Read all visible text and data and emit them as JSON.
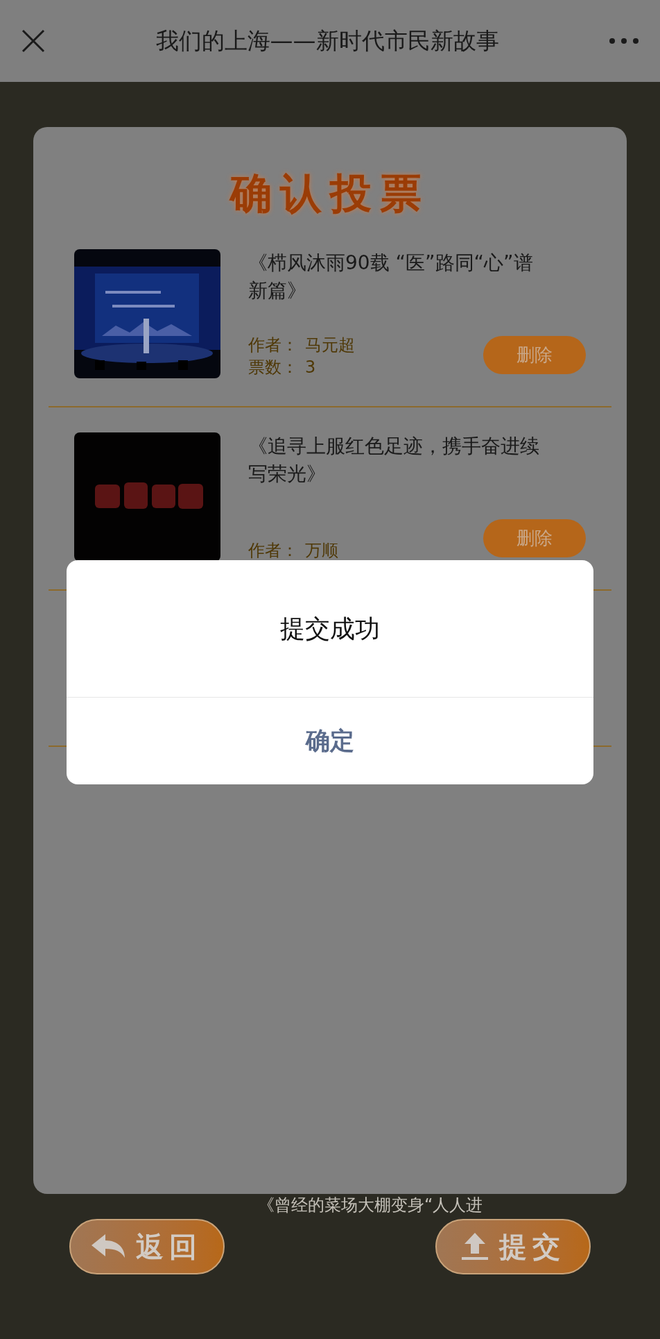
{
  "header": {
    "title": "我们的上海——新时代市民新故事"
  },
  "panel": {
    "title": "确认投票",
    "items": [
      {
        "title": "《栉风沐雨90载 “医”路同“心”谱新篇》",
        "author_label": "作者：",
        "author": "马元超",
        "votes_label": "票数：",
        "votes": "3",
        "delete_button": "删除"
      },
      {
        "title": "《追寻上服红色足迹，携手奋进续写荣光》",
        "author_label": "作者：",
        "author": "万顺",
        "delete_button": "删除"
      }
    ]
  },
  "background_text": "《曾经的菜场大棚变身“人人进",
  "dialog": {
    "message": "提交成功",
    "confirm_button": "确定"
  },
  "footer": {
    "back_button": "返回",
    "submit_button": "提交"
  }
}
